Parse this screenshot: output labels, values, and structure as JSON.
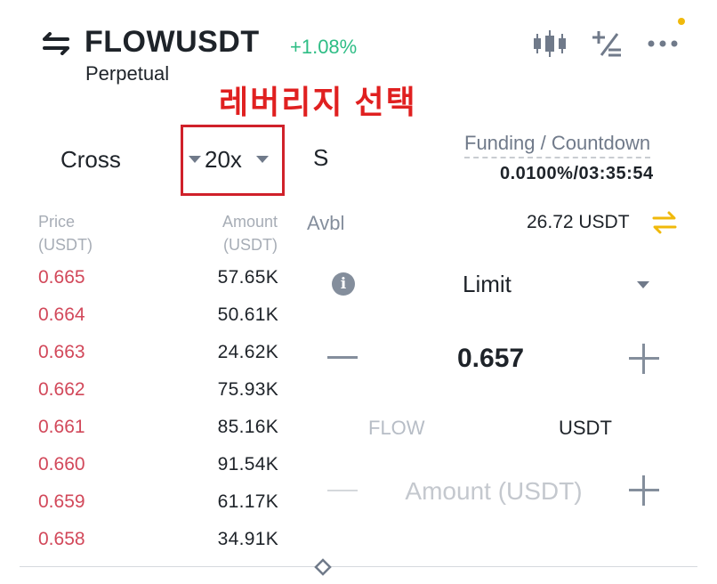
{
  "header": {
    "symbol": "FLOWUSDT",
    "change": "+1.08%",
    "contract_type": "Perpetual",
    "icons": [
      "swap-icon",
      "candlestick-chart-icon",
      "percent-calculator-icon",
      "more-icon"
    ]
  },
  "annotation": "레버리지 선택",
  "controls": {
    "margin_mode": "Cross",
    "leverage": "20x",
    "position_mode": "S"
  },
  "funding": {
    "label": "Funding / Countdown",
    "value": "0.0100%/03:35:54"
  },
  "order_book": {
    "price_header": [
      "Price",
      "(USDT)"
    ],
    "amount_header": [
      "Amount",
      "(USDT)"
    ],
    "rows": [
      {
        "price": "0.665",
        "amount": "57.65K"
      },
      {
        "price": "0.664",
        "amount": "50.61K"
      },
      {
        "price": "0.663",
        "amount": "24.62K"
      },
      {
        "price": "0.662",
        "amount": "75.93K"
      },
      {
        "price": "0.661",
        "amount": "85.16K"
      },
      {
        "price": "0.660",
        "amount": "91.54K"
      },
      {
        "price": "0.659",
        "amount": "61.17K"
      },
      {
        "price": "0.658",
        "amount": "34.91K"
      }
    ]
  },
  "order_form": {
    "avbl_label": "Avbl",
    "avbl_value": "26.72 USDT",
    "order_type": "Limit",
    "price": "0.657",
    "unit_flow": "FLOW",
    "unit_usdt": "USDT",
    "amount_placeholder": "Amount (USDT)"
  },
  "colors": {
    "positive": "#2ebd85",
    "ask": "#d2485a",
    "accent": "#f0b90b",
    "annotation": "#e02020"
  }
}
